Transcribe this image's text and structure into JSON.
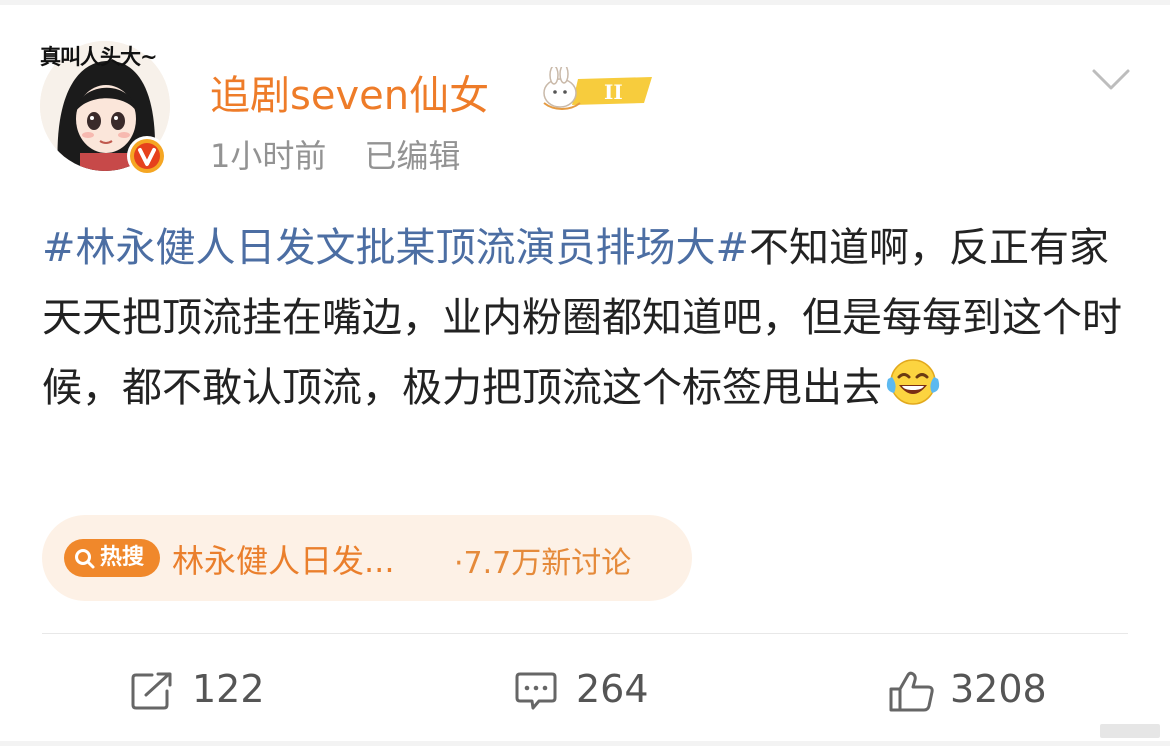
{
  "post": {
    "avatar_caption": "真叫人头大~",
    "username": "追剧seven仙女",
    "level_badge": "II",
    "time": "1小时前",
    "edited": "已编辑",
    "hashtag": "#林永健人日发文批某顶流演员排场大#",
    "body": "不知道啊，反正有家天天把顶流挂在嘴边，业内粉圈都知道吧，但是每每到这个时候，都不敢认顶流，极力把顶流这个标签甩出去",
    "emoji": "laughing-crying-emoji"
  },
  "hot_search": {
    "tag": "热搜",
    "title": "林永健人日发...",
    "count": "·7.7万新讨论"
  },
  "actions": {
    "repost": "122",
    "comment": "264",
    "like": "3208"
  },
  "colors": {
    "username": "#ee7c29",
    "hashtag": "#4c6ea3",
    "hot_tag_bg": "#f0882b",
    "hot_pill_bg": "#fdf1e6"
  }
}
